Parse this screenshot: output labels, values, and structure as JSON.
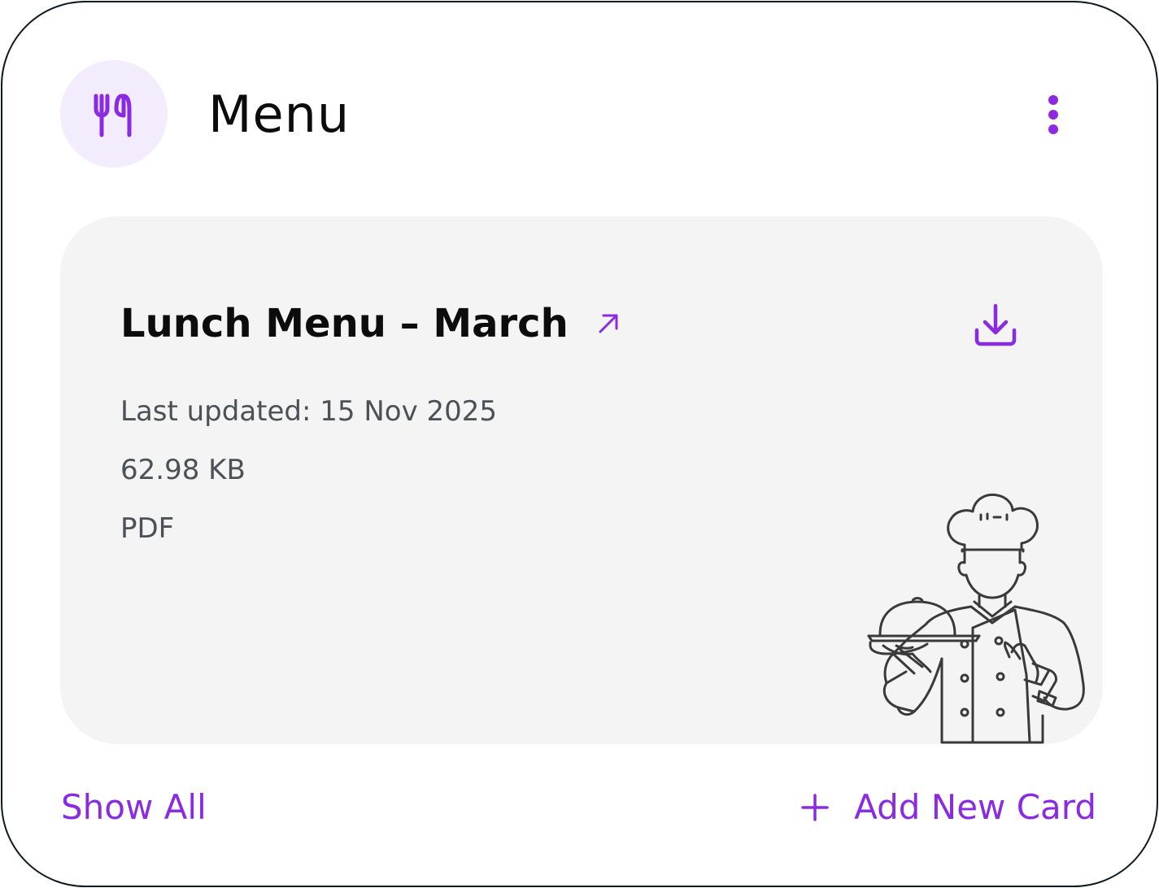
{
  "header": {
    "title": "Menu",
    "icon": "utensils-icon",
    "menu_icon": "more-vertical-icon"
  },
  "card": {
    "title": "Lunch Menu – March",
    "open_icon": "arrow-up-right-icon",
    "download_icon": "download-icon",
    "last_updated": "Last updated: 15 Nov 2025",
    "file_size": "62.98 KB",
    "file_type": "PDF",
    "illustration": "chef-with-cloche-illustration"
  },
  "footer": {
    "show_all_label": "Show All",
    "add_card_label": "Add New Card",
    "add_icon": "plus-icon"
  },
  "colors": {
    "accent": "#8a2be2",
    "accent_soft": "#f3ecfd",
    "card_bg": "#f4f4f4",
    "border": "#101a21",
    "text_primary": "#0c0c0c",
    "text_secondary": "#4e5057"
  }
}
